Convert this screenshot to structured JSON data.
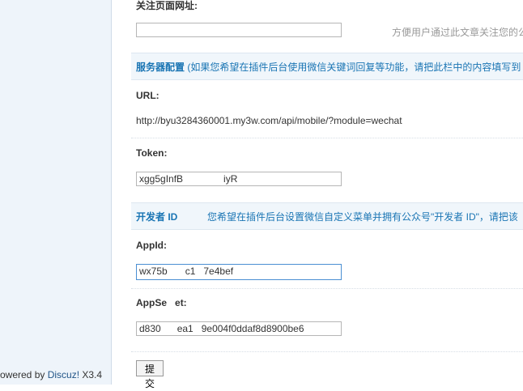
{
  "footer": {
    "powered_prefix": "owered by ",
    "brand": "Discuz!",
    "version": " X3.4"
  },
  "form": {
    "follow_url_label": "关注页面网址:",
    "follow_url_value": "",
    "follow_url_hint": "方便用户通过此文章关注您的公",
    "server_section_title": "服务器配置",
    "server_section_desc": "(如果您希望在插件后台使用微信关键词回复等功能，请把此栏中的内容填写到",
    "url_label": "URL:",
    "url_value": "http://byu3284360001.my3w.com/api/mobile/?module=wechat",
    "token_label": "Token:",
    "token_value": "xgg5gInfB",
    "token_value_end": "iyR",
    "dev_section_title": "开发者 ID",
    "dev_section_desc": "您希望在插件后台设置微信自定义菜单并拥有公众号\"开发者 ID\"，请把该",
    "appid_label": "AppId:",
    "appid_value": "wx75b",
    "appid_value_mid": "c1",
    "appid_value_end": "7e4bef",
    "appsecret_label": "AppSe",
    "appsecret_label_end": "et:",
    "appsecret_value": "d830",
    "appsecret_value_mid": "ea1",
    "appsecret_value_end": "9e004f0ddaf8d8900be6",
    "submit_label": "提交"
  }
}
